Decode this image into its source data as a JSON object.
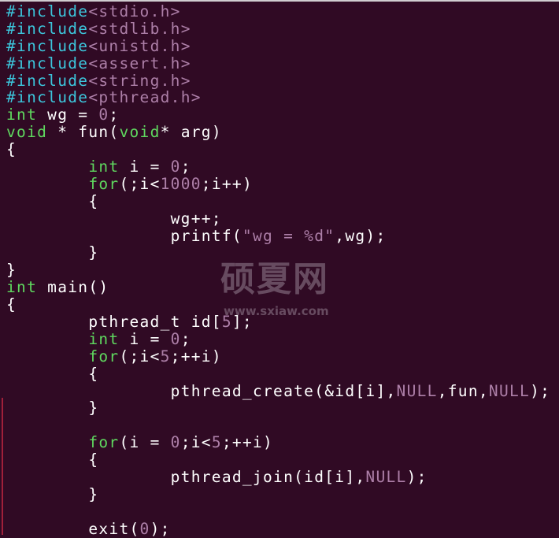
{
  "colors": {
    "background": "#300a24",
    "preprocessor": "#3cc6dc",
    "type_keyword": "#5fd85f",
    "literal": "#ad7fa8",
    "text": "#ffffff"
  },
  "watermark": {
    "text": "硕夏网",
    "url": "www.sxiaw.com"
  },
  "code": [
    [
      [
        "pp",
        "#include"
      ],
      [
        "inc",
        "<stdio.h>"
      ]
    ],
    [
      [
        "pp",
        "#include"
      ],
      [
        "inc",
        "<stdlib.h>"
      ]
    ],
    [
      [
        "pp",
        "#include"
      ],
      [
        "inc",
        "<unistd.h>"
      ]
    ],
    [
      [
        "pp",
        "#include"
      ],
      [
        "inc",
        "<assert.h>"
      ]
    ],
    [
      [
        "pp",
        "#include"
      ],
      [
        "inc",
        "<string.h>"
      ]
    ],
    [
      [
        "pp",
        "#include"
      ],
      [
        "inc",
        "<pthread.h>"
      ]
    ],
    [
      [
        "ty",
        "int"
      ],
      [
        "tx",
        " wg = "
      ],
      [
        "num",
        "0"
      ],
      [
        "tx",
        ";"
      ]
    ],
    [
      [
        "ty",
        "void"
      ],
      [
        "tx",
        " * fun("
      ],
      [
        "ty",
        "void"
      ],
      [
        "tx",
        "* arg)"
      ]
    ],
    [
      [
        "tx",
        "{"
      ]
    ],
    [
      [
        "tx",
        "        "
      ],
      [
        "ty",
        "int"
      ],
      [
        "tx",
        " i = "
      ],
      [
        "num",
        "0"
      ],
      [
        "tx",
        ";"
      ]
    ],
    [
      [
        "tx",
        "        "
      ],
      [
        "ty",
        "for"
      ],
      [
        "tx",
        "(;i<"
      ],
      [
        "num",
        "1000"
      ],
      [
        "tx",
        ";i++)"
      ]
    ],
    [
      [
        "tx",
        "        {"
      ]
    ],
    [
      [
        "tx",
        "                wg++;"
      ]
    ],
    [
      [
        "tx",
        "                printf("
      ],
      [
        "str",
        "\"wg = %d\""
      ],
      [
        "tx",
        ",wg);"
      ]
    ],
    [
      [
        "tx",
        "        }"
      ]
    ],
    [
      [
        "tx",
        "}"
      ]
    ],
    [
      [
        "ty",
        "int"
      ],
      [
        "tx",
        " main()"
      ]
    ],
    [
      [
        "tx",
        "{"
      ]
    ],
    [
      [
        "tx",
        "        pthread_t id["
      ],
      [
        "num",
        "5"
      ],
      [
        "tx",
        "];"
      ]
    ],
    [
      [
        "tx",
        "        "
      ],
      [
        "ty",
        "int"
      ],
      [
        "tx",
        " i = "
      ],
      [
        "num",
        "0"
      ],
      [
        "tx",
        ";"
      ]
    ],
    [
      [
        "tx",
        "        "
      ],
      [
        "ty",
        "for"
      ],
      [
        "tx",
        "(;i<"
      ],
      [
        "num",
        "5"
      ],
      [
        "tx",
        ";++i)"
      ]
    ],
    [
      [
        "tx",
        "        {"
      ]
    ],
    [
      [
        "tx",
        "                pthread_create(&id[i],"
      ],
      [
        "num",
        "NULL"
      ],
      [
        "tx",
        ",fun,"
      ],
      [
        "num",
        "NULL"
      ],
      [
        "tx",
        ");"
      ]
    ],
    [
      [
        "tx",
        "        }"
      ]
    ],
    [
      [
        "tx",
        ""
      ]
    ],
    [
      [
        "tx",
        "        "
      ],
      [
        "ty",
        "for"
      ],
      [
        "tx",
        "(i = "
      ],
      [
        "num",
        "0"
      ],
      [
        "tx",
        ";i<"
      ],
      [
        "num",
        "5"
      ],
      [
        "tx",
        ";++i)"
      ]
    ],
    [
      [
        "tx",
        "        {"
      ]
    ],
    [
      [
        "tx",
        "                pthread_join(id[i],"
      ],
      [
        "num",
        "NULL"
      ],
      [
        "tx",
        ");"
      ]
    ],
    [
      [
        "tx",
        "        }"
      ]
    ],
    [
      [
        "tx",
        ""
      ]
    ],
    [
      [
        "tx",
        "        exit("
      ],
      [
        "num",
        "0"
      ],
      [
        "tx",
        ");"
      ]
    ]
  ]
}
